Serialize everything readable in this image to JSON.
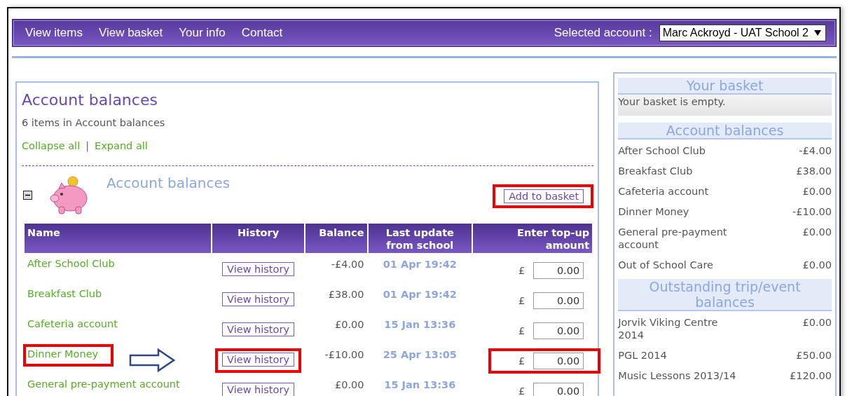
{
  "nav": {
    "links": [
      "View items",
      "View basket",
      "Your info",
      "Contact"
    ],
    "account_label": "Selected account :",
    "account_value": "Marc Ackroyd - UAT School 2"
  },
  "main": {
    "title": "Account balances",
    "count": "6 items in Account balances",
    "collapse": "Collapse all",
    "separator": "|",
    "expand": "Expand all",
    "section": {
      "title": "Account balances",
      "expanded": true,
      "add_button": {
        "label": "Add to basket",
        "annotated": true
      },
      "columns": [
        "Name",
        "History",
        "Balance",
        "Last update from school",
        "Enter top-up amount"
      ],
      "rows": [
        {
          "name": "After School Club",
          "history": "View history",
          "balance": "-£4.00",
          "updated": "01 Apr 19:42",
          "currency": "£",
          "amount": "0.00",
          "annotated": false
        },
        {
          "name": "Breakfast Club",
          "history": "View history",
          "balance": "£38.00",
          "updated": "01 Apr 19:42",
          "currency": "£",
          "amount": "0.00",
          "annotated": false
        },
        {
          "name": "Cafeteria account",
          "history": "View history",
          "balance": "£0.00",
          "updated": "15 Jan 13:36",
          "currency": "£",
          "amount": "0.00",
          "annotated": false
        },
        {
          "name": "Dinner Money",
          "history": "View history",
          "balance": "-£10.00",
          "updated": "25 Apr 13:05",
          "currency": "£",
          "amount": "0.00",
          "annotated": true
        },
        {
          "name": "General pre-payment account",
          "history": "View history",
          "balance": "£0.00",
          "updated": "15 Jan 13:36",
          "currency": "£",
          "amount": "0.00",
          "annotated": false
        }
      ]
    }
  },
  "sidebar": {
    "basket_title": "Your basket",
    "basket_text": "Your basket is empty.",
    "sections": [
      {
        "title": "Account balances",
        "items": [
          {
            "name": "After School Club",
            "amount": "-£4.00"
          },
          {
            "name": "Breakfast Club",
            "amount": "£38.00"
          },
          {
            "name": "Cafeteria account",
            "amount": "£0.00"
          },
          {
            "name": "Dinner Money",
            "amount": "-£10.00"
          },
          {
            "name": "General pre-payment account",
            "amount": "£0.00"
          },
          {
            "name": "Out of School Care",
            "amount": "£0.00"
          }
        ]
      },
      {
        "title": "Outstanding trip/event balances",
        "items": [
          {
            "name": "Jorvik Viking Centre 2014",
            "amount": "£0.00"
          },
          {
            "name": "PGL 2014",
            "amount": "£50.00"
          },
          {
            "name": "Music Lessons 2013/14",
            "amount": "£120.00"
          }
        ]
      }
    ]
  }
}
